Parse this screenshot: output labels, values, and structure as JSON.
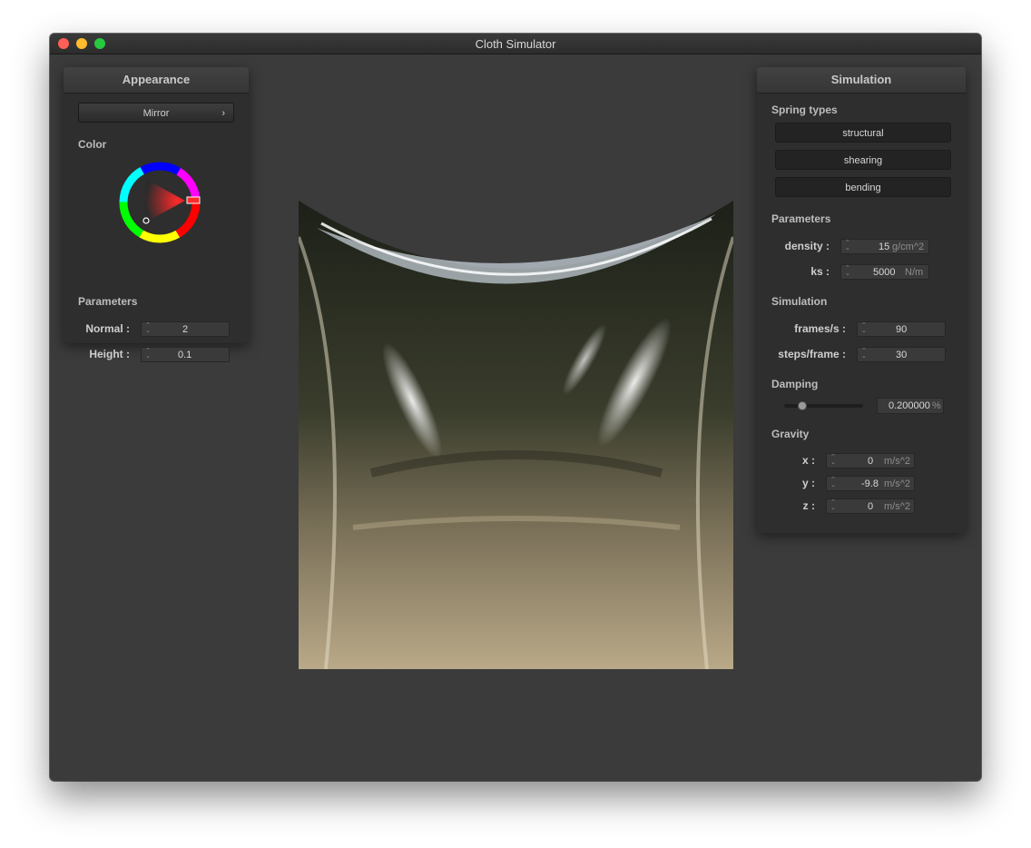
{
  "window": {
    "title": "Cloth Simulator"
  },
  "appearance": {
    "header": "Appearance",
    "shader_select": "Mirror",
    "shader_chevron": "›",
    "color_label": "Color",
    "params_label": "Parameters",
    "normal_label": "Normal :",
    "normal_value": "2",
    "height_label": "Height :",
    "height_value": "0.1"
  },
  "simulation": {
    "header": "Simulation",
    "spring_types_label": "Spring types",
    "spring_types": [
      "structural",
      "shearing",
      "bending"
    ],
    "params_label": "Parameters",
    "density_label": "density :",
    "density_value": "15",
    "density_unit": "g/cm^2",
    "ks_label": "ks :",
    "ks_value": "5000",
    "ks_unit": "N/m",
    "sim_label": "Simulation",
    "fps_label": "frames/s :",
    "fps_value": "90",
    "steps_label": "steps/frame :",
    "steps_value": "30",
    "damping_label": "Damping",
    "damping_value": "0.200000",
    "damping_unit": "%",
    "damping_level": 0.2,
    "gravity_label": "Gravity",
    "gx_label": "x :",
    "gx_value": "0",
    "gy_label": "y :",
    "gy_value": "-9.8",
    "gz_label": "z :",
    "gz_value": "0",
    "g_unit": "m/s^2"
  },
  "colors": {
    "window_bg": "#3b3b3b",
    "panel_bg": "#2e2e2e",
    "wheel_selected": "#ff2a2a"
  },
  "icons": {
    "spinner": "up-down-arrows-icon",
    "chevron": "chevron-right-icon"
  }
}
